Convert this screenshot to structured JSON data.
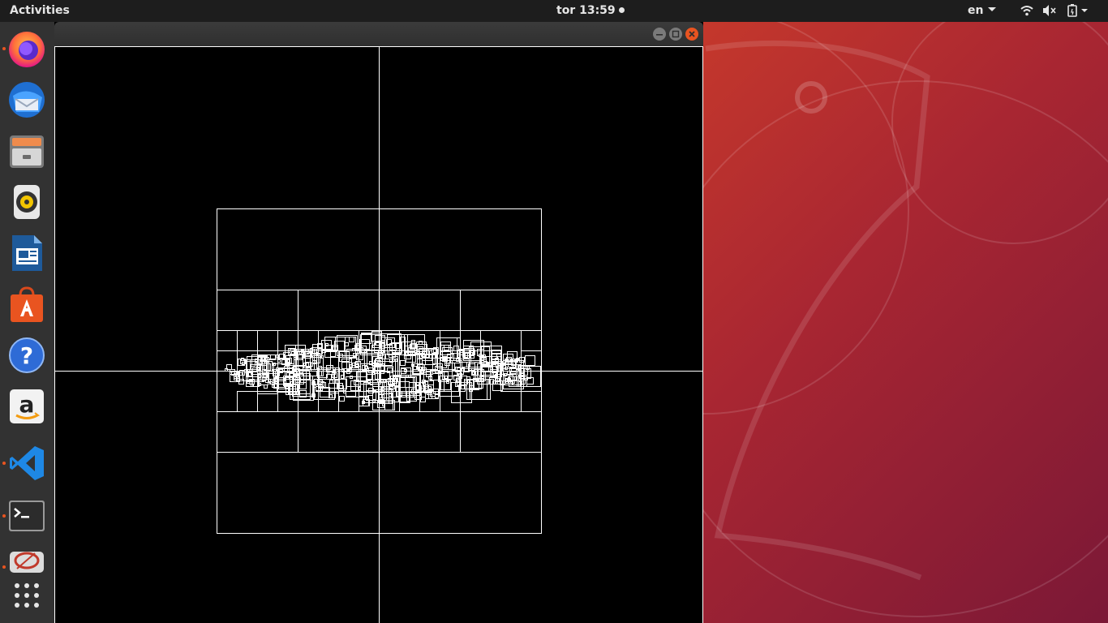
{
  "topbar": {
    "activities_label": "Activities",
    "clock": "tor 13:59",
    "language": "en",
    "status_icons": [
      "wifi-icon",
      "volume-muted-icon",
      "battery-icon"
    ]
  },
  "dock": {
    "items": [
      {
        "name": "firefox",
        "icon": "firefox-icon",
        "running": true
      },
      {
        "name": "thunderbird",
        "icon": "thunderbird-icon",
        "running": false
      },
      {
        "name": "files",
        "icon": "files-icon",
        "running": false
      },
      {
        "name": "rhythmbox",
        "icon": "rhythmbox-icon",
        "running": false
      },
      {
        "name": "libreoffice-writer",
        "icon": "writer-icon",
        "running": false
      },
      {
        "name": "ubuntu-software",
        "icon": "software-store-icon",
        "running": false
      },
      {
        "name": "help",
        "icon": "help-icon",
        "running": false
      },
      {
        "name": "amazon",
        "icon": "amazon-icon",
        "running": false
      },
      {
        "name": "vscode",
        "icon": "vscode-icon",
        "running": true
      },
      {
        "name": "terminal",
        "icon": "terminal-icon",
        "running": true
      },
      {
        "name": "app-running",
        "icon": "app-icon",
        "running": true
      },
      {
        "name": "show-applications",
        "icon": "app-grid-icon",
        "running": false
      }
    ]
  },
  "window": {
    "title": "",
    "content": "quadtree-visualization",
    "buttons": [
      "minimize-icon",
      "maximize-icon",
      "close-icon"
    ]
  },
  "colors": {
    "topbar": "#1d1d1d",
    "dock": "#323232",
    "accent": "#e95420",
    "window_bg": "#000000",
    "lines": "#ffffff"
  }
}
